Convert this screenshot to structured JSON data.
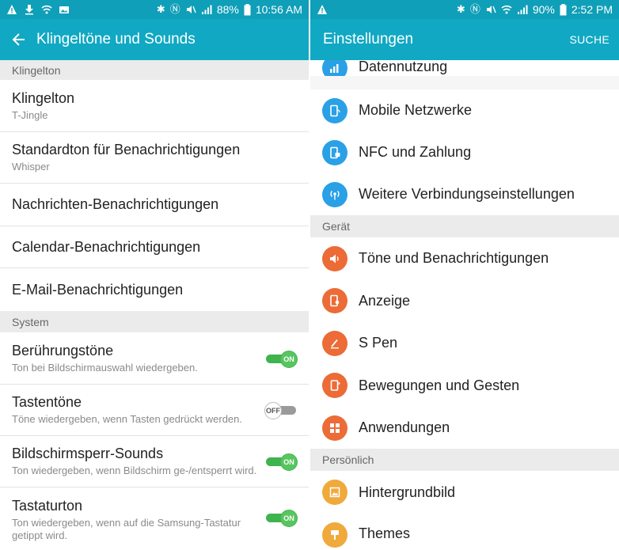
{
  "colors": {
    "teal_dark": "#0f9fb8",
    "teal": "#11a8c3",
    "toggle_on": "#3fb34d",
    "blue_icon": "#2aa0e6",
    "orange_icon": "#ec6b36",
    "yellow_icon": "#f0a93b"
  },
  "left": {
    "status": {
      "battery": "88%",
      "time": "10:56 AM",
      "icons": [
        "warning-icon",
        "download-icon",
        "wifi-icon",
        "photo-icon",
        "bluetooth-icon",
        "nfc-icon",
        "mute-icon",
        "signal-icon"
      ]
    },
    "title": "Klingeltöne und Sounds",
    "section_klingelton": "Klingelton",
    "rows": [
      {
        "title": "Klingelton",
        "sub": "T-Jingle"
      },
      {
        "title": "Standardton für Benachrichtigungen",
        "sub": "Whisper"
      },
      {
        "title": "Nachrichten-Benachrichtigungen"
      },
      {
        "title": "Calendar-Benachrichtigungen"
      },
      {
        "title": "E-Mail-Benachrichtigungen"
      }
    ],
    "section_system": "System",
    "system_rows": [
      {
        "title": "Berührungstöne",
        "sub": "Ton bei Bildschirmauswahl wiedergeben.",
        "toggle": "ON"
      },
      {
        "title": "Tastentöne",
        "sub": "Töne wiedergeben, wenn Tasten gedrückt werden.",
        "toggle": "OFF"
      },
      {
        "title": "Bildschirmsperr-Sounds",
        "sub": "Ton wiedergeben, wenn Bildschirm ge-/entsperrt wird.",
        "toggle": "ON"
      },
      {
        "title": "Tastaturton",
        "sub": "Ton wiedergeben, wenn auf die Samsung-Tastatur getippt wird.",
        "toggle": "ON"
      }
    ]
  },
  "right": {
    "status": {
      "battery": "90%",
      "time": "2:52 PM",
      "icons": [
        "warning-icon",
        "bluetooth-icon",
        "nfc-icon",
        "mute-icon",
        "wifi-icon",
        "signal-icon"
      ]
    },
    "title": "Einstellungen",
    "search_label": "SUCHE",
    "connection_items": [
      {
        "label": "Datennutzung",
        "icon": "data-usage-icon"
      },
      {
        "label": "Mobile Netzwerke",
        "icon": "mobile-networks-icon"
      },
      {
        "label": "NFC und Zahlung",
        "icon": "nfc-payment-icon"
      },
      {
        "label": "Weitere Verbindungseinstellungen",
        "icon": "more-connections-icon"
      }
    ],
    "section_geraet": "Gerät",
    "device_items": [
      {
        "label": "Töne und Benachrichtigungen",
        "icon": "sound-icon"
      },
      {
        "label": "Anzeige",
        "icon": "display-icon"
      },
      {
        "label": "S Pen",
        "icon": "pen-icon"
      },
      {
        "label": "Bewegungen und Gesten",
        "icon": "motion-icon"
      },
      {
        "label": "Anwendungen",
        "icon": "apps-icon"
      }
    ],
    "section_persoenlich": "Persönlich",
    "personal_items": [
      {
        "label": "Hintergrundbild",
        "icon": "wallpaper-icon"
      },
      {
        "label": "Themes",
        "icon": "themes-icon"
      }
    ]
  }
}
